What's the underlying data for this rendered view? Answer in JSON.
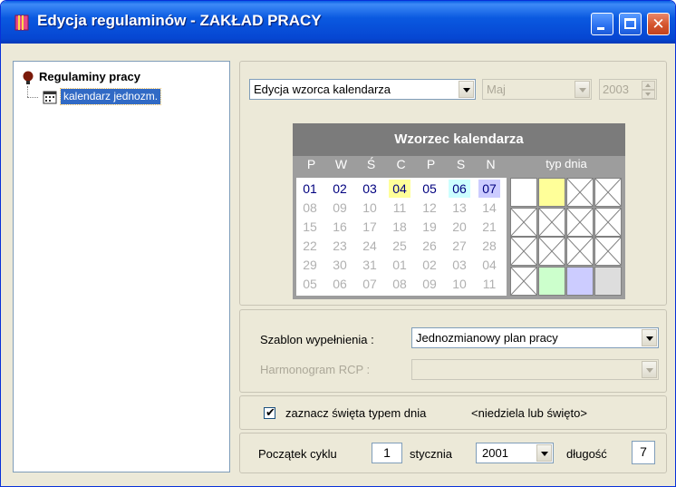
{
  "window": {
    "title": "Edycja regulaminów - ZAKŁAD PRACY",
    "accent": "#0a59e0"
  },
  "tree": {
    "root_label": "Regulaminy pracy",
    "root_icon": "lightbulb-icon",
    "child_label": "kalendarz jednozm.",
    "child_icon": "calendar-icon"
  },
  "toolbar": {
    "mode_value": "Edycja wzorca kalendarza",
    "month_value": "Maj",
    "year_value": "2003"
  },
  "calendar": {
    "title": "Wzorzec kalendarza",
    "day_headers": [
      "P",
      "W",
      "Ś",
      "C",
      "P",
      "S",
      "N"
    ],
    "type_header": "typ dnia",
    "weeks": [
      [
        "01",
        "02",
        "03",
        "04",
        "05",
        "06",
        "07"
      ],
      [
        "08",
        "09",
        "10",
        "11",
        "12",
        "13",
        "14"
      ],
      [
        "15",
        "16",
        "17",
        "18",
        "19",
        "20",
        "21"
      ],
      [
        "22",
        "23",
        "24",
        "25",
        "26",
        "27",
        "28"
      ],
      [
        "29",
        "30",
        "31",
        "01",
        "02",
        "03",
        "04"
      ],
      [
        "05",
        "06",
        "07",
        "08",
        "09",
        "10",
        "11"
      ]
    ],
    "day_highlight_colors": {
      "0": "#ffffff",
      "1": "#ffffff",
      "2": "#ffffff",
      "3": "#ffff99",
      "4": "#ffffff",
      "5": "#ccffff",
      "6": "#ccccff"
    },
    "active_text_color": "#00007f",
    "inactive_text_color": "#b0b0b0",
    "type_cells": [
      [
        "white",
        "yellow",
        "cross",
        "cross"
      ],
      [
        "cross",
        "cross",
        "cross",
        "cross"
      ],
      [
        "cross",
        "cross",
        "cross",
        "cross"
      ],
      [
        "cross",
        "green",
        "lavender",
        "gray"
      ]
    ],
    "type_colors": {
      "white": "#ffffff",
      "yellow": "#ffff99",
      "green": "#ccffcc",
      "lavender": "#ccccff",
      "gray": "#dddddd"
    }
  },
  "settings": {
    "template_label": "Szablon wypełnienia :",
    "template_value": "Jednozmianowy plan pracy",
    "schedule_label": "Harmonogram RCP :",
    "schedule_value": ""
  },
  "holidays": {
    "checked": true,
    "label": "zaznacz święta typem dnia",
    "note": "<niedziela lub święto>"
  },
  "cycle": {
    "start_label": "Początek cyklu",
    "day": "1",
    "month": "stycznia",
    "year": "2001",
    "length_label": "długość",
    "length": "7"
  }
}
